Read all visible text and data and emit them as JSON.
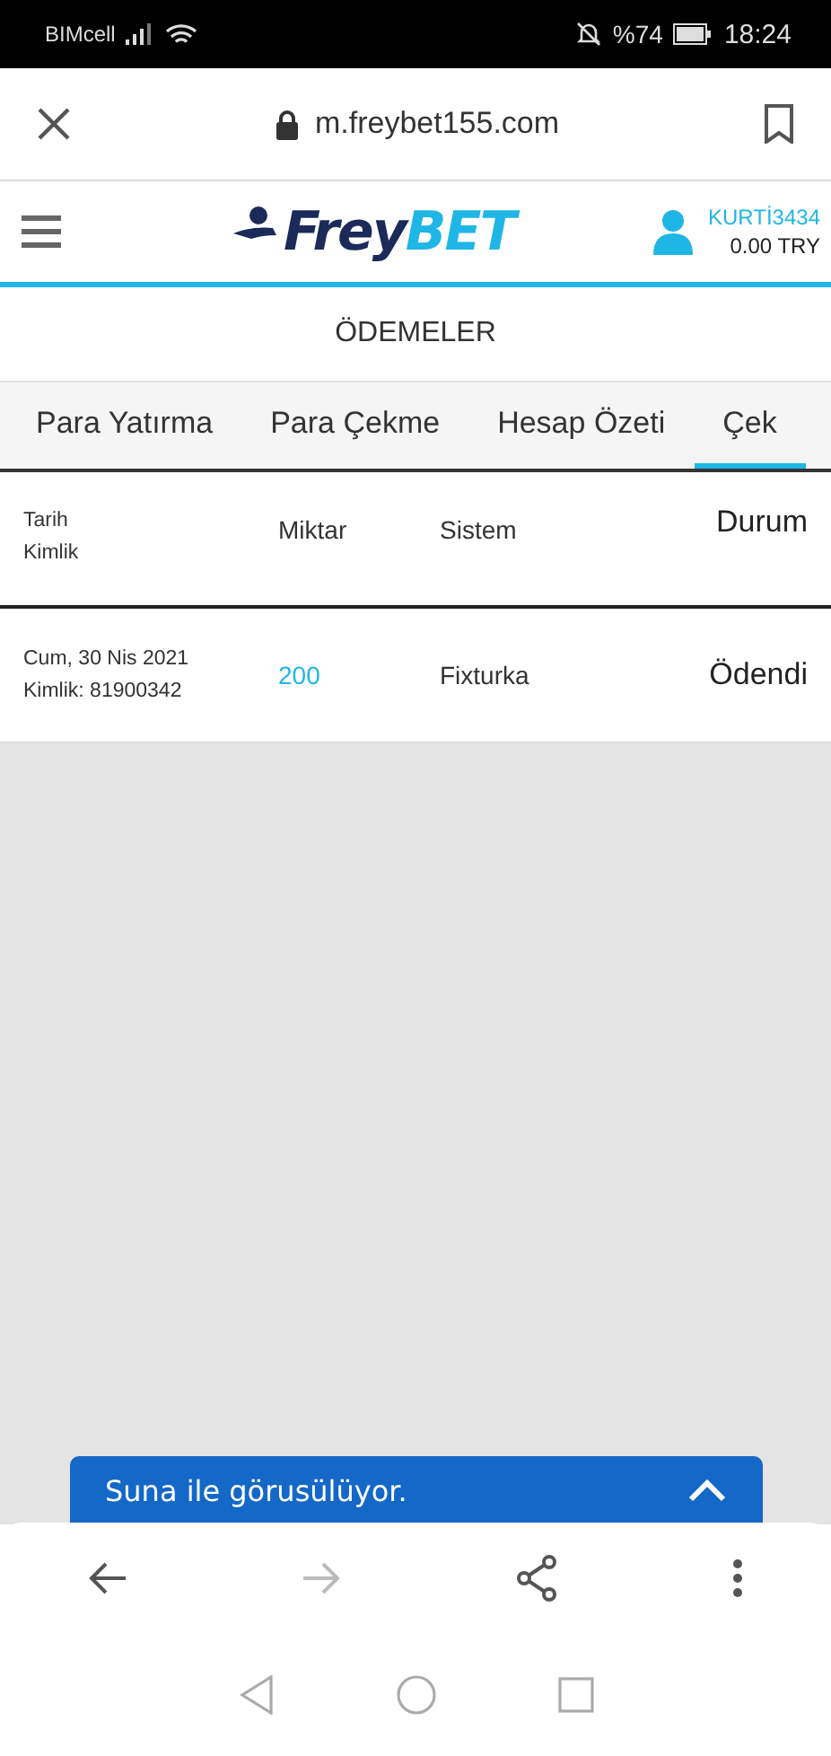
{
  "status_bar": {
    "carrier": "BIMcell",
    "battery": "%74",
    "time": "18:24"
  },
  "browser": {
    "url": "m.freybet155.com"
  },
  "header": {
    "logo_main": "Frey",
    "logo_accent": "BET",
    "username": "KURTİ3434",
    "balance": "0.00 TRY"
  },
  "page_title": "ÖDEMELER",
  "tabs": [
    {
      "label": "Para Yatırma",
      "selected": false
    },
    {
      "label": "Para Çekme",
      "selected": false
    },
    {
      "label": "Hesap Özeti",
      "selected": false
    },
    {
      "label": "Çek",
      "selected": true
    }
  ],
  "table": {
    "columns": [
      [
        "Tarih",
        "Kimlik"
      ],
      "Miktar",
      "Sistem",
      "Durum"
    ],
    "rows": [
      {
        "date": "Cum, 30 Nis 2021",
        "id": "Kimlik: 81900342",
        "amount": "200",
        "system": "Fixturka",
        "status": "Ödendi"
      }
    ]
  },
  "chat_bar": {
    "text": "Suna ile görusülüyor."
  }
}
